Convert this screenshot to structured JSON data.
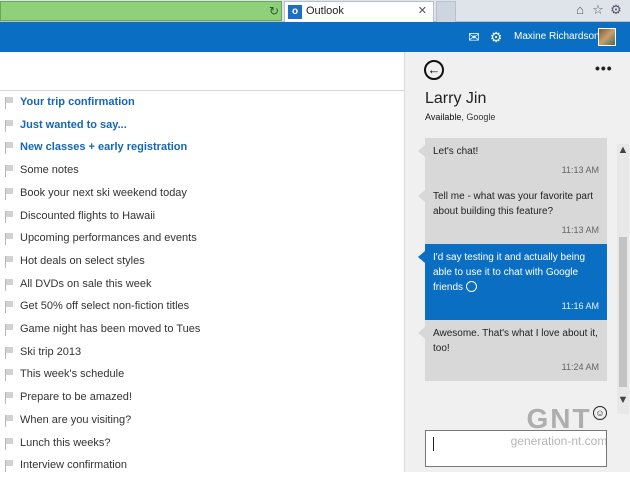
{
  "browser": {
    "tab_title": "Outlook",
    "tab_icon_letter": "o",
    "close_glyph": "✕",
    "refresh_glyph": "↻",
    "home_glyph": "⌂",
    "star_glyph": "☆",
    "gear_glyph": "⚙"
  },
  "header": {
    "user_name": "Maxine Richardson",
    "chat_glyph": "✉",
    "settings_glyph": "⚙"
  },
  "mail_list": {
    "items": [
      {
        "subject": "Your trip confirmation",
        "unread": true
      },
      {
        "subject": "Just wanted to say...",
        "unread": true
      },
      {
        "subject": "New classes + early registration",
        "unread": true
      },
      {
        "subject": "Some notes",
        "unread": false
      },
      {
        "subject": "Book your next ski weekend today",
        "unread": false
      },
      {
        "subject": "Discounted flights to Hawaii",
        "unread": false
      },
      {
        "subject": "Upcoming performances and events",
        "unread": false
      },
      {
        "subject": "Hot deals on select styles",
        "unread": false
      },
      {
        "subject": "All DVDs on sale this week",
        "unread": false
      },
      {
        "subject": "Get 50% off select non-fiction titles",
        "unread": false
      },
      {
        "subject": "Game night has been moved to Tues",
        "unread": false
      },
      {
        "subject": "Ski trip 2013",
        "unread": false
      },
      {
        "subject": "This week's schedule",
        "unread": false
      },
      {
        "subject": "Prepare to be amazed!",
        "unread": false
      },
      {
        "subject": "When are you visiting?",
        "unread": false
      },
      {
        "subject": "Lunch this weeks?",
        "unread": false
      },
      {
        "subject": "Interview confirmation",
        "unread": false
      }
    ]
  },
  "chat": {
    "back_glyph": "←",
    "more_glyph": "•••",
    "contact_name": "Larry Jin",
    "status": "Available",
    "network": ", Google",
    "messages": [
      {
        "text": "Let's chat!",
        "time": "11:13 AM",
        "mine": false
      },
      {
        "text": "Tell me - what was your favorite part about building this feature?",
        "time": "11:13 AM",
        "mine": false
      },
      {
        "text": "I'd say testing it and actually being able to use it to chat with Google friends",
        "time": "11:16 AM",
        "mine": true
      },
      {
        "text": "Awesome. That's what I love about it, too!",
        "time": "11:24 AM",
        "mine": false
      }
    ],
    "emoji_glyph": "☺",
    "input_value": "",
    "scroll_up": "▲",
    "scroll_down": "▼"
  },
  "watermark": {
    "logo": "GNT",
    "site": "generation-nt.com"
  }
}
